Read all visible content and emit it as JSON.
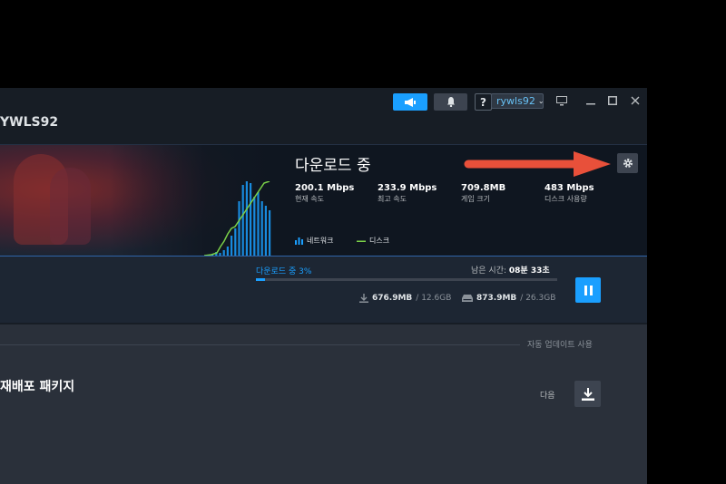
{
  "titlebar": {
    "user_title": "YWLS92",
    "account_name": "rywls92",
    "help_label": "?"
  },
  "download": {
    "title": "다운로드 중",
    "stats": [
      {
        "value": "200.1 Mbps",
        "label": "현재 속도"
      },
      {
        "value": "233.9 Mbps",
        "label": "최고 속도"
      },
      {
        "value": "709.8MB",
        "label": "게임 크기"
      },
      {
        "value": "483 Mbps",
        "label": "디스크 사용량"
      }
    ],
    "legend": {
      "network": "네트워크",
      "disk": "디스크"
    },
    "colors": {
      "network": "#1a9fff",
      "disk": "#7bd148",
      "accent": "#1a9fff",
      "arrow": "#e8503a"
    }
  },
  "progress": {
    "label": "다운로드 중 3%",
    "percent": 3,
    "remaining_label": "남은 시간:",
    "remaining_value": "08분 33초",
    "network_done": "676.9MB",
    "network_total": "/ 12.6GB",
    "disk_done": "873.9MB",
    "disk_total": "/ 26.3GB"
  },
  "queue": {
    "auto_update": "자동 업데이트 사용",
    "package_title": "재배포 패키지",
    "next_label": "다음"
  }
}
